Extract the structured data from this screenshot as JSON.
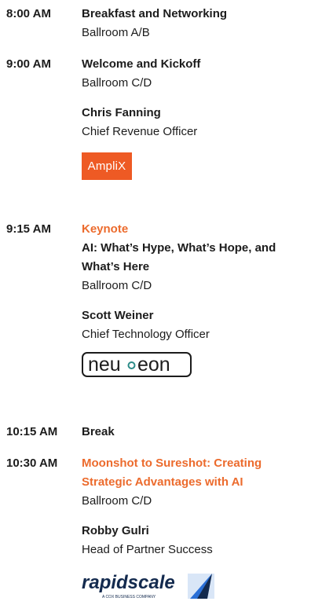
{
  "sessions": [
    {
      "time": "8:00 AM",
      "title": "Breakfast and Networking",
      "room": "Ballroom A/B"
    },
    {
      "time": "9:00 AM",
      "title": "Welcome and Kickoff",
      "room": "Ballroom C/D",
      "speaker": {
        "name": "Chris Fanning",
        "role": "Chief Revenue Officer",
        "logo_text": "AmpliX"
      }
    },
    {
      "time": "9:15 AM",
      "tag": "Keynote",
      "title_line1": "AI: What’s Hype, What’s Hope, and",
      "title_line2": "What’s Here",
      "room": "Ballroom C/D",
      "speaker": {
        "name": "Scott Weiner",
        "role": "Chief Technology Officer",
        "logo_text_a": "neu",
        "logo_text_b": "eon"
      }
    },
    {
      "time": "10:15 AM",
      "title": "Break"
    },
    {
      "time": "10:30 AM",
      "title_line1": "Moonshot to Sureshot: Creating",
      "title_line2": "Strategic Advantages with AI",
      "room": "Ballroom C/D",
      "speaker": {
        "name": "Robby Gulri",
        "role": "Head of Partner Success",
        "logo_text": "rapidscale",
        "logo_subtext": "A COX BUSINESS COMPANY"
      }
    }
  ],
  "colors": {
    "accent": "#ec6b2d",
    "text": "#1c1c1c",
    "amplix_bg": "#ee5a24",
    "neueon_teal": "#2b8b88",
    "rapidscale_navy": "#132a4e",
    "rapidscale_blue": "#2a6fd6"
  }
}
